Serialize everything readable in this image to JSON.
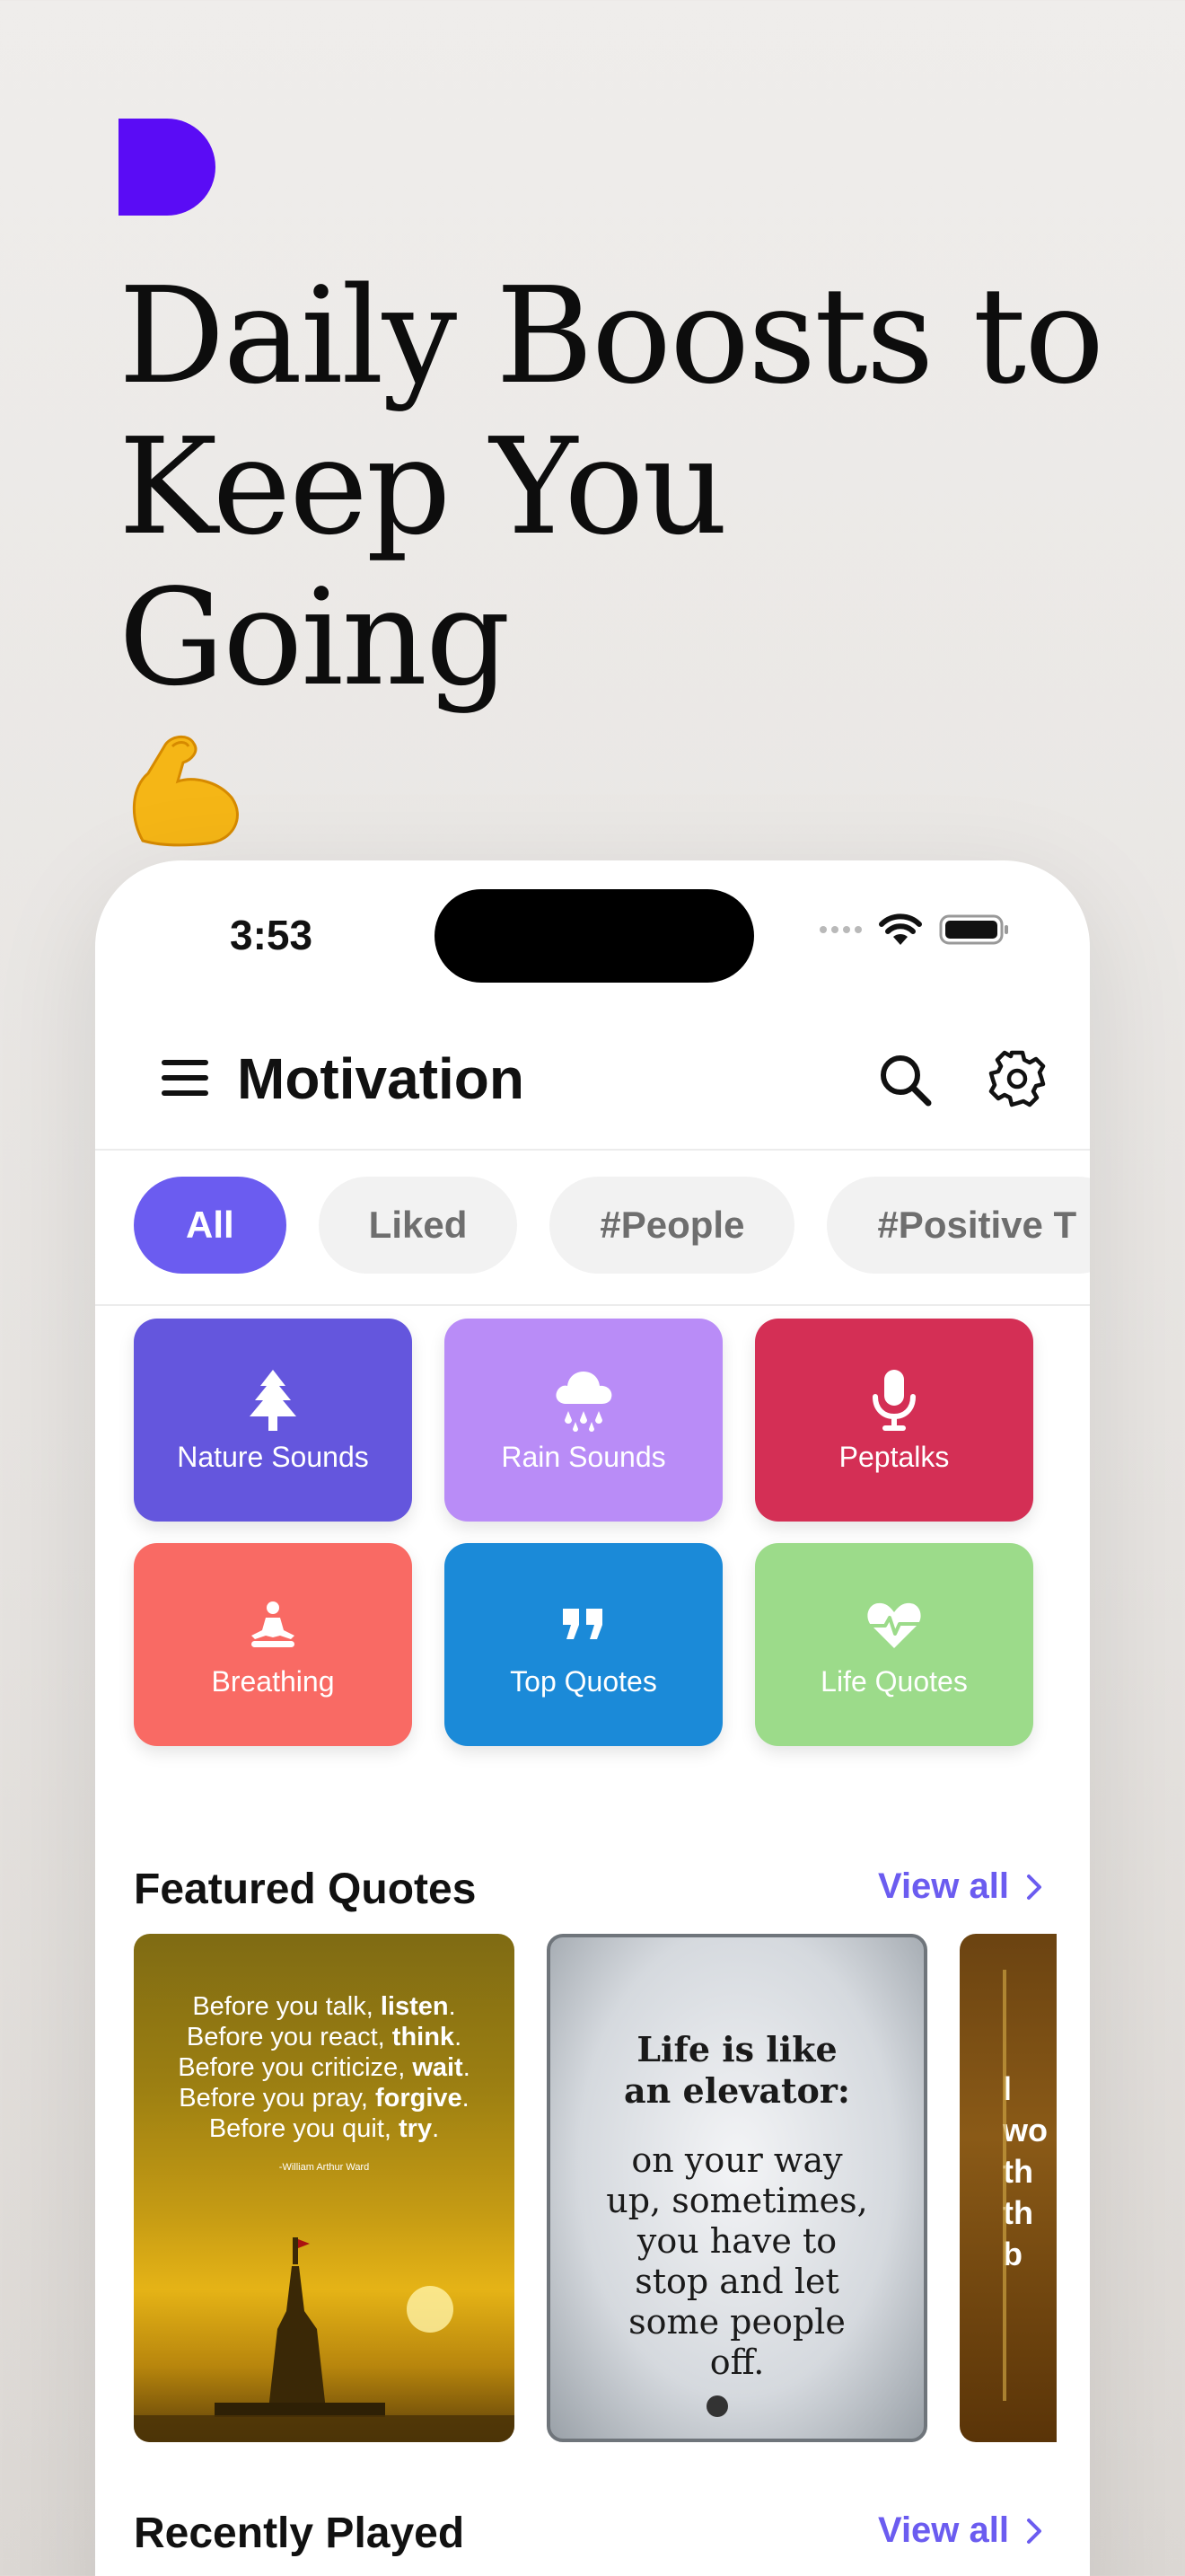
{
  "headline": {
    "line1": "Daily Boosts to",
    "line2": "Keep You Going",
    "emoji": "💪"
  },
  "colors": {
    "brand": "#5a0cf5",
    "accent": "#6b5cf0"
  },
  "status_bar": {
    "time": "3:53"
  },
  "header": {
    "title": "Motivation"
  },
  "chips": [
    {
      "label": "All",
      "active": true
    },
    {
      "label": "Liked",
      "active": false
    },
    {
      "label": "#People",
      "active": false
    },
    {
      "label": "#Positive T",
      "active": false
    }
  ],
  "categories": [
    {
      "label": "Nature Sounds",
      "icon": "tree-icon",
      "color": "#6456dd"
    },
    {
      "label": "Rain Sounds",
      "icon": "cloud-rain-icon",
      "color": "#b98cf7"
    },
    {
      "label": "Peptalks",
      "icon": "microphone-icon",
      "color": "#d42f55"
    },
    {
      "label": "Breathing",
      "icon": "meditation-icon",
      "color": "#f96a64"
    },
    {
      "label": "Top Quotes",
      "icon": "quote-icon",
      "color": "#1b8ad8"
    },
    {
      "label": "Life Quotes",
      "icon": "heart-pulse-icon",
      "color": "#9cdb8a"
    }
  ],
  "featured": {
    "title": "Featured Quotes",
    "view_all": "View all",
    "cards": [
      {
        "lines": [
          {
            "pre": "Before you talk, ",
            "bold": "listen",
            "post": "."
          },
          {
            "pre": "Before you react, ",
            "bold": "think",
            "post": "."
          },
          {
            "pre": "Before you criticize, ",
            "bold": "wait",
            "post": "."
          },
          {
            "pre": "Before you pray, ",
            "bold": "forgive",
            "post": "."
          },
          {
            "pre": "Before you quit, ",
            "bold": "try",
            "post": "."
          }
        ],
        "author": "-William Arthur Ward"
      },
      {
        "title": "Life is like an elevator:",
        "body": "on your way up, sometimes, you have to stop and let some people off."
      },
      {
        "fragment": [
          "l",
          "wo",
          "th",
          "th",
          "b"
        ]
      }
    ]
  },
  "recent": {
    "title": "Recently Played",
    "view_all": "View all"
  }
}
